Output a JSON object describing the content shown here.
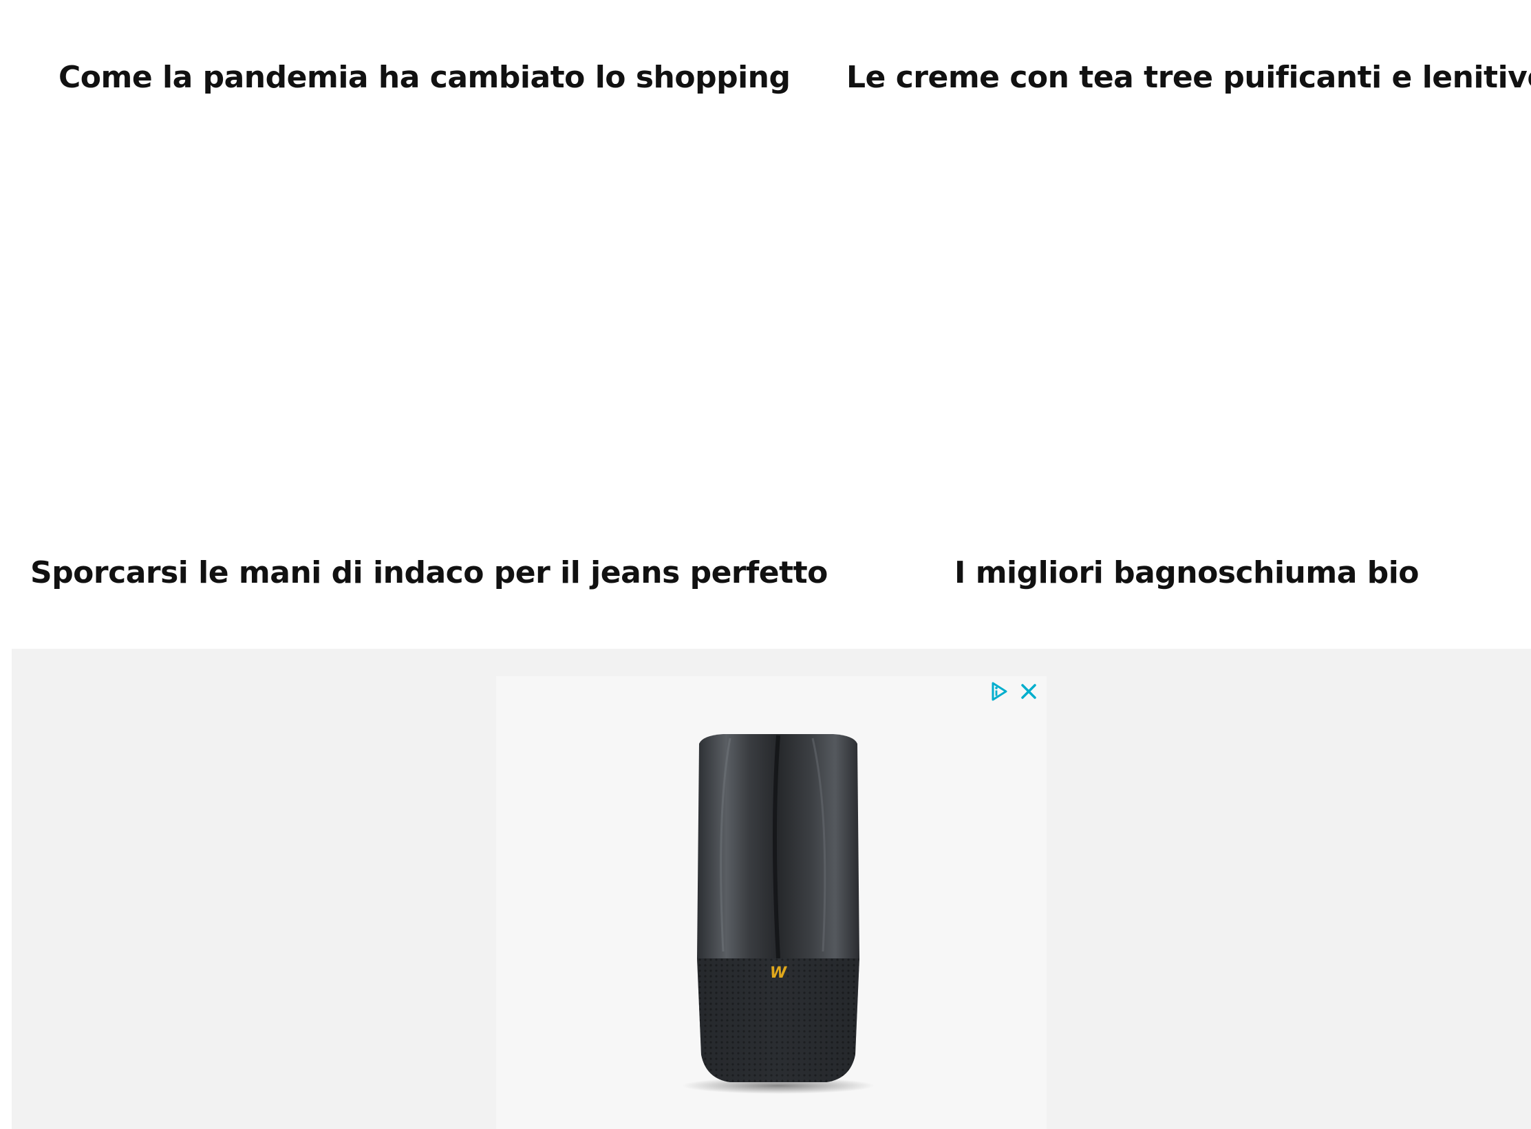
{
  "articles": [
    {
      "title": "Come la pandemia ha cambiato lo shopping"
    },
    {
      "title": "Le creme con tea tree puificanti e lenitive"
    },
    {
      "title": "Sporcarsi le mani di indaco per il jeans perfetto"
    },
    {
      "title": "I migliori bagnoschiuma bio"
    }
  ],
  "ad": {
    "adchoices_icon": "adchoices-icon",
    "close_icon": "close-icon",
    "accent_color": "#00aecd",
    "product_image": "air-purifier-product"
  }
}
